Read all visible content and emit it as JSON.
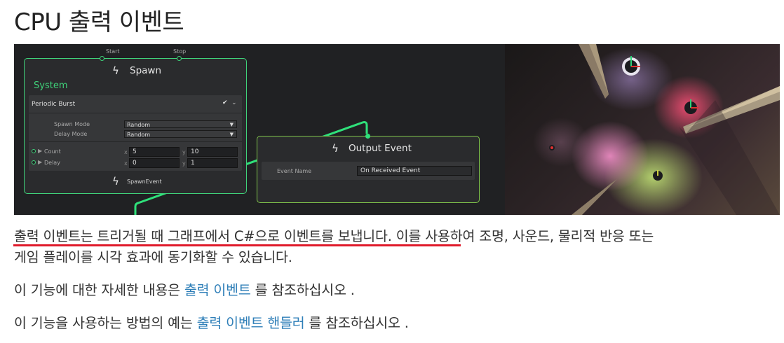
{
  "page": {
    "title": "CPU 출력 이벤트"
  },
  "graph": {
    "spawn_node": {
      "start_label": "Start",
      "stop_label": "Stop",
      "title": "Spawn",
      "context_label": "System",
      "block_title": "Periodic Burst",
      "spawn_mode_label": "Spawn Mode",
      "spawn_mode_value": "Random",
      "delay_mode_label": "Delay Mode",
      "delay_mode_value": "Random",
      "count_label": "Count",
      "count_x_label": "x",
      "count_x": "5",
      "count_y_label": "y",
      "count_y": "10",
      "delay_label": "Delay",
      "delay_x_label": "x",
      "delay_x": "0",
      "delay_y_label": "y",
      "delay_y": "1",
      "output_label": "SpawnEvent"
    },
    "output_node": {
      "title": "Output Event",
      "event_name_label": "Event Name",
      "event_name_value": "On Received Event"
    },
    "colors": {
      "node_border": "#3fd27a",
      "output_border": "#7fc44a",
      "wire": "#2fe07a",
      "context_text": "#3fd27a"
    }
  },
  "content": {
    "para1_highlight": "출력 이벤트는 트리거될 때 그래프에서 C#으로 이벤트를 보냅니다",
    "para1_rest_line1": ". 이를 사용하여 조명, 사운드, 물리적 반응 또는",
    "para1_line2": "게임 플레이를 시각 효과에 동기화할 수 있습니다.",
    "para2_prefix": "이 기능에 대한 자세한 내용은 ",
    "para2_link": "출력 이벤트",
    "para2_suffix": " 를 참조하십시오 .",
    "para3_prefix": "이 기능을 사용하는 방법의 예는 ",
    "para3_link": "출력 이벤트 핸들러",
    "para3_suffix": " 를 참조하십시오 .",
    "link_color": "#2f7fb8",
    "annotation_color": "#e01a2b"
  }
}
